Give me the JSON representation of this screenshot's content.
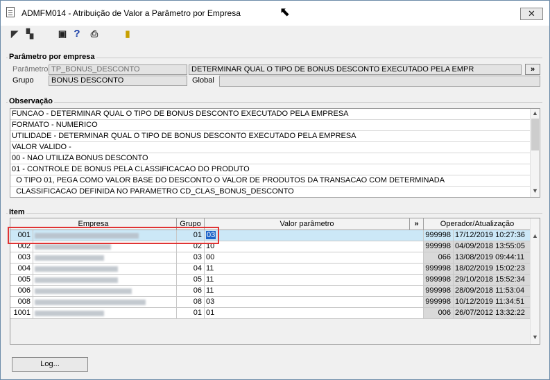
{
  "window": {
    "title": "ADMFM014 - Atribuição de Valor a Parâmetro por Empresa",
    "close_label": "✕"
  },
  "toolbar": {
    "icons": [
      "arrow-left-icon",
      "grid-icon",
      "save-icon",
      "help-icon",
      "print-icon",
      "exit-icon"
    ]
  },
  "param_section": {
    "title": "Parâmetro por empresa",
    "param_label": "Parâmetro",
    "param_value": "TP_BONUS_DESCONTO",
    "param_desc": "DETERMINAR QUAL O TIPO DE BONUS DESCONTO EXECUTADO PELA EMPR",
    "expand_label": "»",
    "group_label": "Grupo",
    "group_value": "BONUS DESCONTO",
    "global_label": "Global",
    "global_value": ""
  },
  "obs_section": {
    "title": "Observação",
    "lines": [
      "FUNCAO - DETERMINAR QUAL O TIPO DE BONUS DESCONTO EXECUTADO PELA EMPRESA",
      "FORMATO - NUMERICO",
      "UTILIDADE - DETERMINAR QUAL O TIPO DE BONUS DESCONTO EXECUTADO PELA EMPRESA",
      "VALOR VALIDO -",
      "00 -  NAO UTILIZA BONUS DESCONTO",
      "01 - CONTROLE DE BONUS PELA CLASSIFICACAO DO PRODUTO",
      "  O TIPO 01, PEGA COMO VALOR BASE DO DESCONTO O VALOR DE PRODUTOS DA TRANSACAO COM DETERMINADA",
      "  CLASSIFICACAO DEFINIDA NO PARAMETRO CD_CLAS_BONUS_DESCONTO"
    ]
  },
  "item_section": {
    "title": "Item",
    "headers": {
      "empresa": "Empresa",
      "grupo": "Grupo",
      "valor": "Valor parâmetro",
      "expand": "»",
      "operador": "Operador/Atualização"
    },
    "rows": [
      {
        "code": "001",
        "grupo": "01",
        "valor": "03",
        "operador": "999998",
        "data": "17/12/2019 10:27:36"
      },
      {
        "code": "002",
        "grupo": "02",
        "valor": "10",
        "operador": "999998",
        "data": "04/09/2018 13:55:05"
      },
      {
        "code": "003",
        "grupo": "03",
        "valor": "00",
        "operador": "066",
        "data": "13/08/2019 09:44:11"
      },
      {
        "code": "004",
        "grupo": "04",
        "valor": "11",
        "operador": "999998",
        "data": "18/02/2019 15:02:23"
      },
      {
        "code": "005",
        "grupo": "05",
        "valor": "11",
        "operador": "999998",
        "data": "29/10/2018 15:52:34"
      },
      {
        "code": "006",
        "grupo": "06",
        "valor": "11",
        "operador": "999998",
        "data": "28/09/2018 11:53:04"
      },
      {
        "code": "008",
        "grupo": "08",
        "valor": "03",
        "operador": "999998",
        "data": "10/12/2019 11:34:51"
      },
      {
        "code": "1001",
        "grupo": "01",
        "valor": "01",
        "operador": "006",
        "data": "26/07/2012 13:32:22"
      }
    ]
  },
  "footer": {
    "log_label": "Log..."
  }
}
